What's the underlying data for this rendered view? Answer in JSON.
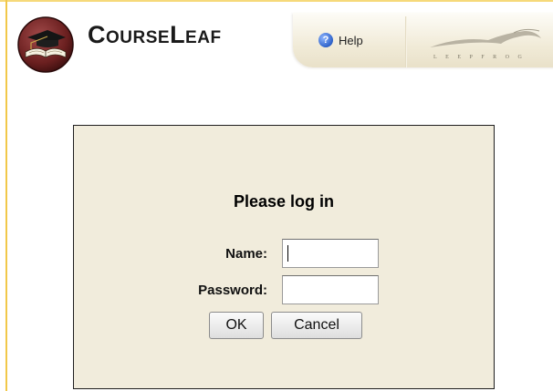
{
  "header": {
    "brand": "CourseLeaf",
    "help_label": "Help",
    "partner_logo_text": "LEEPFROG"
  },
  "login": {
    "title": "Please log in",
    "name_label": "Name:",
    "name_value": "",
    "password_label": "Password:",
    "password_value": "",
    "ok_label": "OK",
    "cancel_label": "Cancel"
  }
}
